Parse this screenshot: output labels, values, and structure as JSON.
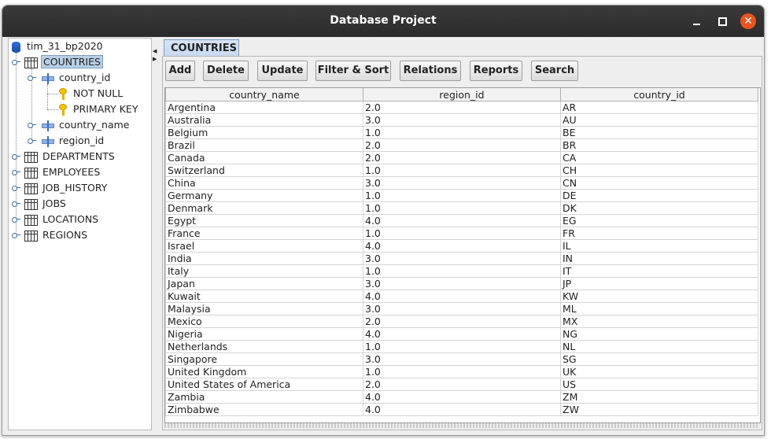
{
  "window": {
    "title": "Database Project",
    "close_glyph": "✕"
  },
  "tree": {
    "root": "tim_31_bp2020",
    "countries": "COUNTRIES",
    "country_id": "country_id",
    "not_null": "NOT NULL",
    "primary_key": "PRIMARY KEY",
    "country_name": "country_name",
    "region_id": "region_id",
    "departments": "DEPARTMENTS",
    "employees": "EMPLOYEES",
    "job_history": "JOB_HISTORY",
    "jobs": "JOBS",
    "locations": "LOCATIONS",
    "regions": "REGIONS"
  },
  "tab": {
    "label": "COUNTRIES"
  },
  "toolbar": {
    "add": "Add",
    "delete": "Delete",
    "update": "Update",
    "filter_sort": "Filter & Sort",
    "relations": "Relations",
    "reports": "Reports",
    "search": "Search"
  },
  "table": {
    "columns": [
      "country_name",
      "region_id",
      "country_id"
    ],
    "rows": [
      [
        "Argentina",
        "2.0",
        "AR"
      ],
      [
        "Australia",
        "3.0",
        "AU"
      ],
      [
        "Belgium",
        "1.0",
        "BE"
      ],
      [
        "Brazil",
        "2.0",
        "BR"
      ],
      [
        "Canada",
        "2.0",
        "CA"
      ],
      [
        "Switzerland",
        "1.0",
        "CH"
      ],
      [
        "China",
        "3.0",
        "CN"
      ],
      [
        "Germany",
        "1.0",
        "DE"
      ],
      [
        "Denmark",
        "1.0",
        "DK"
      ],
      [
        "Egypt",
        "4.0",
        "EG"
      ],
      [
        "France",
        "1.0",
        "FR"
      ],
      [
        "Israel",
        "4.0",
        "IL"
      ],
      [
        "India",
        "3.0",
        "IN"
      ],
      [
        "Italy",
        "1.0",
        "IT"
      ],
      [
        "Japan",
        "3.0",
        "JP"
      ],
      [
        "Kuwait",
        "4.0",
        "KW"
      ],
      [
        "Malaysia",
        "3.0",
        "ML"
      ],
      [
        "Mexico",
        "2.0",
        "MX"
      ],
      [
        "Nigeria",
        "4.0",
        "NG"
      ],
      [
        "Netherlands",
        "1.0",
        "NL"
      ],
      [
        "Singapore",
        "3.0",
        "SG"
      ],
      [
        "United Kingdom",
        "1.0",
        "UK"
      ],
      [
        "United States of America",
        "2.0",
        "US"
      ],
      [
        "Zambia",
        "4.0",
        "ZM"
      ],
      [
        "Zimbabwe",
        "4.0",
        "ZW"
      ]
    ]
  },
  "colors": {
    "titlebar": "#2b2b2b",
    "close_button": "#e95420",
    "tab_background": "#c7daf0",
    "selection": "#b8cfe5"
  }
}
